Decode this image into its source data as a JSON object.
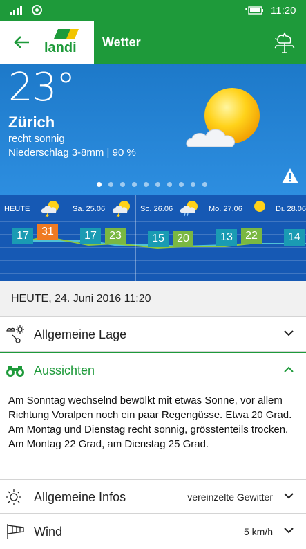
{
  "status_bar": {
    "time": "11:20"
  },
  "header": {
    "title": "Wetter",
    "logo_text": "Landi",
    "back_icon": "arrow-left-icon",
    "action_icon": "rooster-weathervane-icon"
  },
  "current": {
    "temperature": "23°",
    "city": "Zürich",
    "condition": "recht sonnig",
    "precipitation": "Niederschlag 3-8mm | 90 %",
    "icon": "sun-cloud-icon",
    "pager_count": 10,
    "pager_active": 0,
    "warning_icon": "warning-triangle-icon"
  },
  "forecast": [
    {
      "label": "HEUTE",
      "min": "17",
      "max": "31",
      "icon": "sun-thunder-icon"
    },
    {
      "label": "Sa. 25.06",
      "min": "17",
      "max": "23",
      "icon": "sun-thunder-icon"
    },
    {
      "label": "So. 26.06",
      "min": "15",
      "max": "20",
      "icon": "sun-cloud-rain-icon"
    },
    {
      "label": "Mo. 27.06",
      "min": "13",
      "max": "22",
      "icon": "sun-icon"
    },
    {
      "label": "Di. 28.06",
      "min": "14",
      "max": "",
      "icon": "sun-icon"
    }
  ],
  "colors": {
    "brand_green": "#1e9a3a",
    "forecast_bg": "#1659b4",
    "low_box": "#1a9bb3",
    "high_box": "#7ab842",
    "hot_box": "#ef7a22"
  },
  "date_bar": "HEUTE, 24. Juni 2016 11:20",
  "sections": [
    {
      "label": "Allgemeine Lage",
      "icon": "weather-symbols-icon",
      "expanded": false,
      "value": ""
    },
    {
      "label": "Aussichten",
      "icon": "binoculars-icon",
      "expanded": true,
      "value": ""
    },
    {
      "label": "Allgemeine Infos",
      "icon": "sun-outline-icon",
      "expanded": false,
      "value": "vereinzelte Gewitter"
    },
    {
      "label": "Wind",
      "icon": "windsock-icon",
      "expanded": false,
      "value": "5 km/h"
    }
  ],
  "outlook_text": "Am Sonntag wechselnd bewölkt mit etwas Sonne, vor allem Richtung Voralpen noch ein paar Regengüsse. Etwa 20 Grad. Am Montag und Dienstag recht sonnig, grösstenteils trocken. Am Montag 22 Grad, am Dienstag 25 Grad."
}
